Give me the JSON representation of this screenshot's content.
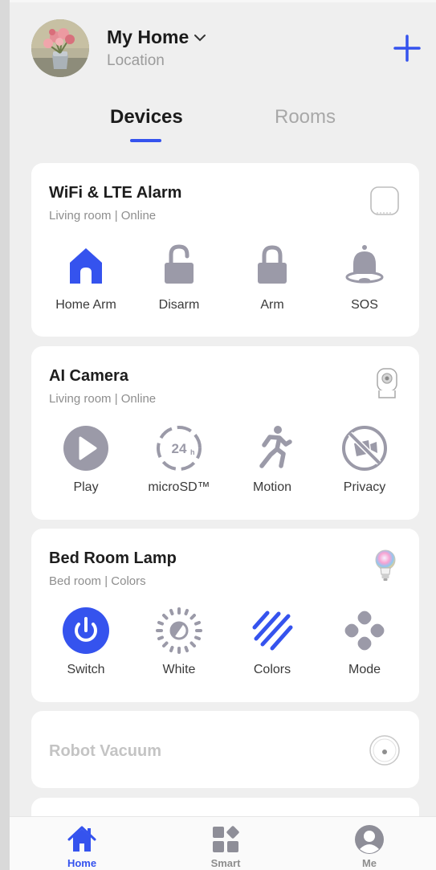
{
  "header": {
    "home_name": "My Home",
    "location": "Location"
  },
  "tabs": [
    {
      "label": "Devices",
      "active": true
    },
    {
      "label": "Rooms",
      "active": false
    }
  ],
  "devices": [
    {
      "name": "WiFi & LTE Alarm",
      "subtitle": "Living room  | Online",
      "device_icon": "alarm-hub-icon",
      "actions": [
        {
          "label": "Home Arm",
          "icon": "home-arm-icon"
        },
        {
          "label": "Disarm",
          "icon": "unlocked-icon"
        },
        {
          "label": "Arm",
          "icon": "locked-icon"
        },
        {
          "label": "SOS",
          "icon": "bell-icon"
        }
      ]
    },
    {
      "name": "AI Camera",
      "subtitle": "Living room  | Online",
      "device_icon": "camera-icon",
      "actions": [
        {
          "label": "Play",
          "icon": "play-icon"
        },
        {
          "label": "microSD™",
          "icon": "microsd-24h-icon"
        },
        {
          "label": "Motion",
          "icon": "running-person-icon"
        },
        {
          "label": "Privacy",
          "icon": "privacy-off-icon"
        }
      ]
    },
    {
      "name": "Bed Room Lamp",
      "subtitle": "Bed room  |  Colors",
      "device_icon": "bulb-icon",
      "actions": [
        {
          "label": "Switch",
          "icon": "power-icon"
        },
        {
          "label": "White",
          "icon": "brightness-icon"
        },
        {
          "label": "Colors",
          "icon": "stripes-icon"
        },
        {
          "label": "Mode",
          "icon": "mode-icon"
        }
      ]
    },
    {
      "name": "Robot Vacuum",
      "subtitle": "",
      "device_icon": "robot-vacuum-icon",
      "actions": []
    }
  ],
  "bottom_nav": [
    {
      "label": "Home",
      "icon": "home-icon",
      "active": true
    },
    {
      "label": "Smart",
      "icon": "smart-grid-icon",
      "active": false
    },
    {
      "label": "Me",
      "icon": "profile-icon",
      "active": false
    }
  ],
  "colors": {
    "accent": "#3553ee",
    "icon_grey": "#9b9aa8",
    "background": "#efefef",
    "card": "#ffffff"
  }
}
